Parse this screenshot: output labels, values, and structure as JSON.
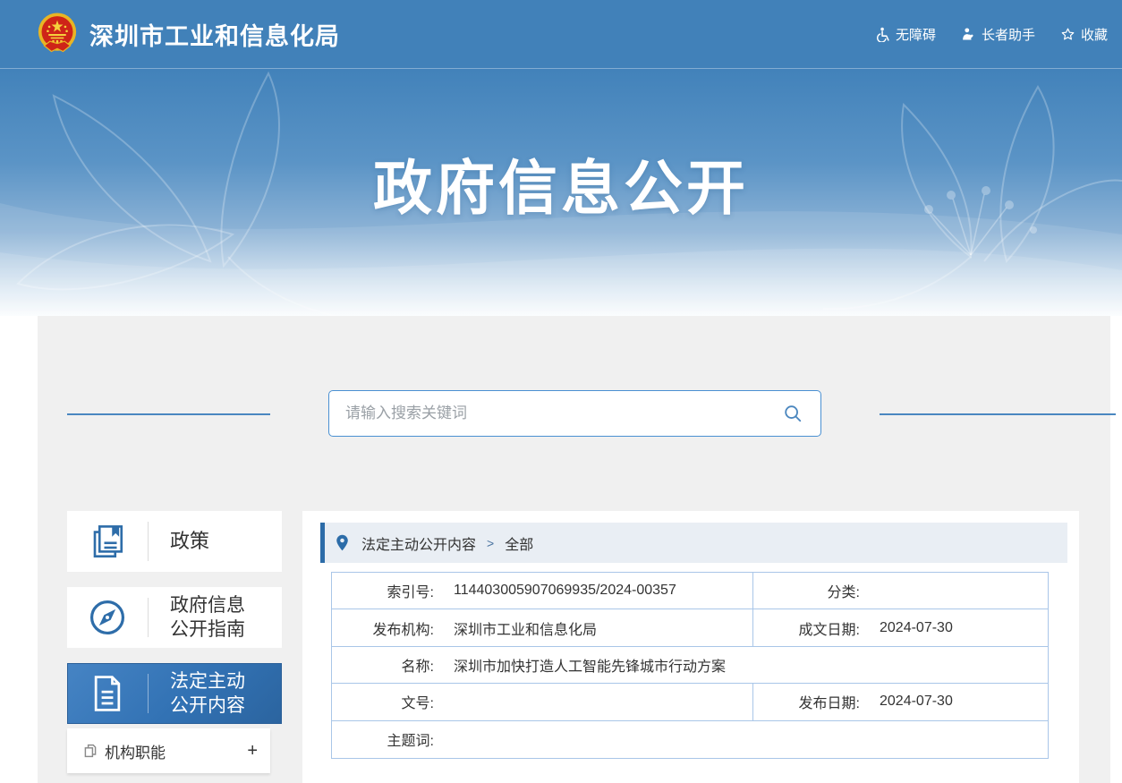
{
  "header": {
    "site_title": "深圳市工业和信息化局",
    "utils": {
      "accessibility": "无障碍",
      "elder_helper": "长者助手",
      "favorite": "收藏"
    }
  },
  "banner": {
    "title": "政府信息公开"
  },
  "search": {
    "placeholder": "请输入搜索关键词"
  },
  "sidebar": {
    "items": [
      {
        "label": "政策"
      },
      {
        "line1": "政府信息",
        "line2": "公开指南"
      },
      {
        "line1": "法定主动",
        "line2": "公开内容"
      }
    ],
    "sub_item": {
      "label": "机构职能",
      "expander": "+"
    }
  },
  "breadcrumb": {
    "section": "法定主动公开内容",
    "separator": ">",
    "current": "全部"
  },
  "doc_table": {
    "index_label": "索引号:",
    "index_value": "114403005907069935/2024-00357",
    "category_label": "分类:",
    "category_value": "",
    "publisher_label": "发布机构:",
    "publisher_value": "深圳市工业和信息化局",
    "date_written_label": "成文日期:",
    "date_written_value": "2024-07-30",
    "name_label": "名称:",
    "name_value": "深圳市加快打造人工智能先锋城市行动方案",
    "doc_no_label": "文号:",
    "doc_no_value": "",
    "date_pub_label": "发布日期:",
    "date_pub_value": "2024-07-30",
    "keywords_label": "主题词:",
    "keywords_value": ""
  },
  "colors": {
    "header_blue": "#4181b9",
    "active_blue": "#3272b4",
    "table_border": "#a9c6e8",
    "breadcrumb_bg": "#e9eef4",
    "panel_gray": "#f0f0f0"
  }
}
